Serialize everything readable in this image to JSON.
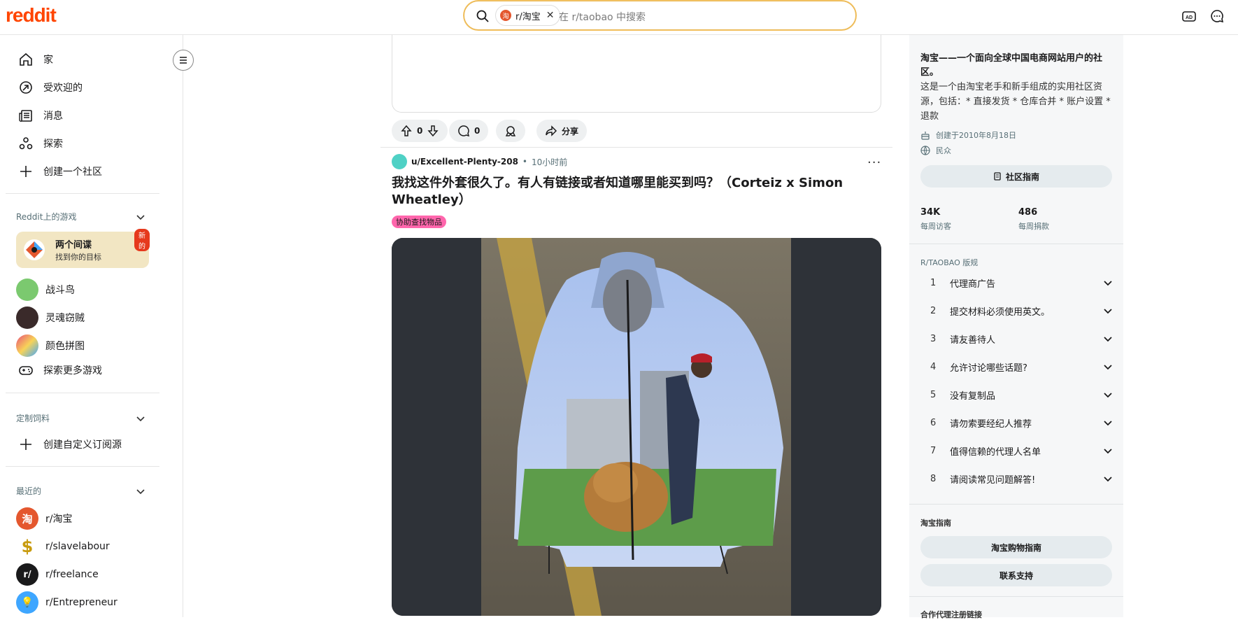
{
  "header": {
    "logo": "reddit",
    "search_chip": "r/淘宝",
    "search_chip_icon": "淘",
    "search_placeholder": "在 r/taobao 中搜索",
    "icons": [
      "ad-icon",
      "chat-icon"
    ]
  },
  "sidebar": {
    "nav": [
      {
        "label": "家",
        "icon": "home-icon"
      },
      {
        "label": "受欢迎的",
        "icon": "popular-icon"
      },
      {
        "label": "消息",
        "icon": "news-icon"
      },
      {
        "label": "探索",
        "icon": "explore-icon"
      },
      {
        "label": "创建一个社区",
        "icon": "plus-icon"
      }
    ],
    "games": {
      "title": "Reddit上的游戏",
      "featured": {
        "title": "两个间谍",
        "subtitle": "找到你的目标",
        "badge": "新的"
      },
      "items": [
        {
          "label": "战斗鸟",
          "color": "#7bc96f"
        },
        {
          "label": "灵魂窃贼",
          "color": "#3a2a2a"
        },
        {
          "label": "颜色拼图",
          "color": "#e94e77"
        }
      ],
      "explore_more": "探索更多游戏"
    },
    "custom_feeds": {
      "title": "定制饲料",
      "create": "创建自定义订阅源"
    },
    "recent": {
      "title": "最近的",
      "items": [
        {
          "label": "r/淘宝",
          "icon_text": "淘",
          "color": "#e4572e"
        },
        {
          "label": "r/slavelabour",
          "icon_text": "$",
          "color": "#f7d358"
        },
        {
          "label": "r/freelance",
          "icon_text": "r/",
          "color": "#1a1a1b"
        },
        {
          "label": "r/Entrepreneur",
          "icon_text": "💡",
          "color": "#3ea6ff"
        }
      ]
    }
  },
  "prev_post": {
    "upvotes": "0",
    "comments": "0",
    "share": "分享"
  },
  "post": {
    "author": "u/Excellent-Plenty-208",
    "separator": "•",
    "time": "10小时前",
    "title": "我找这件外套很久了。有人有链接或者知道哪里能买到吗？（Corteiz x Simon Wheatley）",
    "flair": "协助查找物品",
    "flair_color": "#ff66ac"
  },
  "community": {
    "title": "淘宝——一个面向全球中国电商网站用户的社区。",
    "description": "这是一个由淘宝老手和新手组成的实用社区资源，包括：* 直接发货 * 仓库合并 * 账户设置 * 退款",
    "created": "创建于2010年8月18日",
    "visibility": "民众",
    "guide_button": "社区指南",
    "stats": [
      {
        "value": "34K",
        "label": "每周访客"
      },
      {
        "value": "486",
        "label": "每周捐款"
      }
    ],
    "rules_title": "R/TAOBAO 版规",
    "rules": [
      {
        "n": "1",
        "text": "代理商广告"
      },
      {
        "n": "2",
        "text": "提交材料必须使用英文。"
      },
      {
        "n": "3",
        "text": "请友善待人"
      },
      {
        "n": "4",
        "text": "允许讨论哪些话题?"
      },
      {
        "n": "5",
        "text": "没有复制品"
      },
      {
        "n": "6",
        "text": "请勿索要经纪人推荐"
      },
      {
        "n": "7",
        "text": "值得信赖的代理人名单"
      },
      {
        "n": "8",
        "text": "请阅读常见问题解答!"
      }
    ],
    "guide_section": "淘宝指南",
    "guide_links": [
      "淘宝购物指南",
      "联系支持"
    ],
    "partner_section": "合作代理注册链接"
  },
  "colors": {
    "brand": "#ff4500",
    "accent_border": "#e8b34a",
    "sidebar_bg": "#f6f7f8"
  }
}
